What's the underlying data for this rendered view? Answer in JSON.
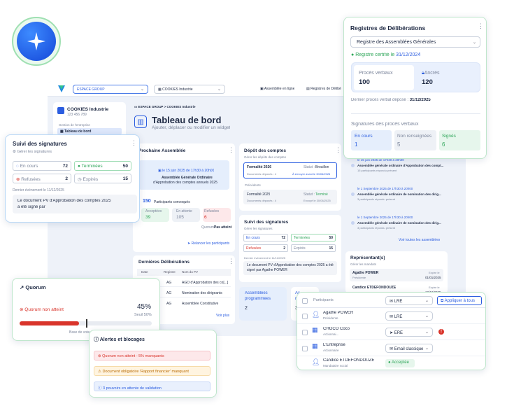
{
  "logo": {
    "icon": "sparkle-icon"
  },
  "topbar": {
    "space_label": "ESPACE GROUP",
    "company_label": "COOKIES Industrie",
    "nav1": "Assemblée en ligne",
    "nav2": "Registres de Délibé"
  },
  "sidebar": {
    "company_name": "COOKIES Industrie",
    "company_id": "123 456 789",
    "section": "Gestion de l'entreprise",
    "item": "Tableau de bord"
  },
  "breadcrumb": "ESPACE GROUP > COOKIES Industrie",
  "page": {
    "title": "Tableau de bord",
    "subtitle": "Ajouter, déplacer ou modifier un widget"
  },
  "prochaine": {
    "title": "Prochaine Assemblée",
    "date": "le 15 juin 2025 de 17h30 à 20h00",
    "line1": "Assemblée Générale Ordinaire",
    "line2": "d'Approbation des comptes annuels 2025",
    "count": "150",
    "count_label": "Participants convoqués",
    "acc_label": "Acceptées",
    "acc_val": "39",
    "att_label": "En attente",
    "att_val": "105",
    "ref_label": "Refusées",
    "ref_val": "6",
    "quorum_label": "Quorum :",
    "quorum_val": "Pas atteint",
    "relancer": "Relancer les participants"
  },
  "depot": {
    "title": "Dépôt des comptes",
    "sub": "Gérer les dépôts des comptes",
    "f1": "Formalité 2026",
    "f1_status_label": "Statut :",
    "f1_status": "Brouillon",
    "f1_docs": "Documents déposés : 4",
    "f1_due": "À envoyer avant le 30/06/2026",
    "prec": "Précédents",
    "f2": "Formalité 2025",
    "f2_status": "Terminé",
    "f2_docs": "Documents déposés : 4",
    "f2_sent": "Envoyé le 30/06/2025"
  },
  "signatures_mid": {
    "title": "Suivi des signatures",
    "sub": "Gérer les signatures",
    "encours": "En cours",
    "encours_val": "72",
    "terminees": "Terminées",
    "terminees_val": "50",
    "refusees": "Refusées",
    "refusees_val": "2",
    "expires": "Expirés",
    "expires_val": "15",
    "last": "Dernier événement le 11/12/2025",
    "doc": "Le document PV d'Approbation des comptes 2025 a été signé par Agathe POWER"
  },
  "timeline": [
    {
      "date": "le 15 juin 2025 de 17h30 à 20h00",
      "title": "Assemblée générale ordinaire d'Approbation des compt...",
      "sub": "15 participants répondu présent"
    },
    {
      "date": "le 1 Septembre 2025 de 17h30 à 20h00",
      "title": "Assemblée générale ordinaire de nomination des dirig...",
      "sub": "3 participants répondu présent"
    },
    {
      "date": "le 1 Septembre 2025 de 17h30 à 20h00",
      "title": "Assemblée générale ordinaire de nomination des dirig...",
      "sub": "3 participants répondu présent"
    }
  ],
  "voir_assemblees": "Voir toutes les assemblées",
  "representants": {
    "title": "Représentant(s)",
    "sub": "Gérer les mandats",
    "r1": "Agathe POWER",
    "r1_role": "Présidente",
    "r1_exp": "Expire le",
    "r1_date": "01/01/2025",
    "r2": "Candice ETDEFONDOUZE",
    "r2_exp": "Expire le",
    "r2_date": "12/12/2025"
  },
  "dernieres": {
    "title": "Dernières Délibérations",
    "cols": [
      "Date",
      "Registre",
      "Nom du PV"
    ],
    "rows": [
      [
        "",
        "AG",
        "AGO d'Approbation des co[...]"
      ],
      [
        "",
        "AG",
        "Nomination des dirigeants"
      ],
      [
        "",
        "AG",
        "Assemblée Constitutive"
      ]
    ],
    "voir": "Voir plus"
  },
  "assemblees_prog": {
    "label1": "Assemblées",
    "label2": "programmées",
    "val": "2",
    "label3": "As",
    "label4": "ré",
    "val2": "3"
  },
  "registres": {
    "title": "Registres de Délibérations",
    "select": "Registre des Assemblées Générales",
    "certified_label": "Registre certifié le",
    "certified_date": "31/12/2024",
    "pv_label": "Procès verbaux",
    "pv_val": "100",
    "ancres_label": "Ancrés",
    "ancres_val": "120",
    "last_label": "Dernier procès verbal déposé :",
    "last_date": "31/12/2025",
    "sig_title": "Signatures des procès verbaux",
    "encours": "En cours",
    "encours_val": "1",
    "nonrens": "Non renseignées",
    "nonrens_val": "5",
    "signes": "Signés",
    "signes_val": "6"
  },
  "suivi": {
    "title": "Suivi des signatures",
    "sub": "Gérer les signatures",
    "encours": "En cours",
    "encours_val": "72",
    "terminees": "Terminées",
    "terminees_val": "50",
    "refusees": "Refusées",
    "refusees_val": "2",
    "expires": "Expirés",
    "expires_val": "15",
    "last": "Dernier événement le 11/12/2025",
    "doc1": "Le document PV d'Approbation des comptes 2025",
    "doc2": "a été signé par"
  },
  "quorum": {
    "title": "Quorum",
    "status": "Quorum non atteint",
    "pct": "45%",
    "seuil": "Seuil 50%",
    "fill": 0.45,
    "threshold": 0.5,
    "base": "Base de vote"
  },
  "alertes": {
    "title": "Alertes et blocages",
    "a1": "Quorum non atteint - 5% manquants",
    "a2": "Document obligatoire 'Rapport financier' manquant",
    "a3": "3 pouvoirs en attente de validation"
  },
  "participants": {
    "header": "Participants",
    "header_select": "LRE",
    "apply": "Appliquer à tous",
    "rows": [
      {
        "name": "Agathe POWER",
        "role": "Présidente",
        "mode": "LRE",
        "warn": false,
        "badge": ""
      },
      {
        "name": "CHOCO Coco",
        "role": "Actionnai...",
        "mode": "ERE",
        "warn": true,
        "badge": ""
      },
      {
        "name": "L'Entreprise",
        "role": "Actionnaire",
        "mode": "Email classique",
        "warn": false,
        "badge": ""
      },
      {
        "name": "Candice ETDEFONDOUZE",
        "role": "Mandataire social",
        "mode": "",
        "warn": false,
        "badge": "Acceptée"
      }
    ]
  }
}
